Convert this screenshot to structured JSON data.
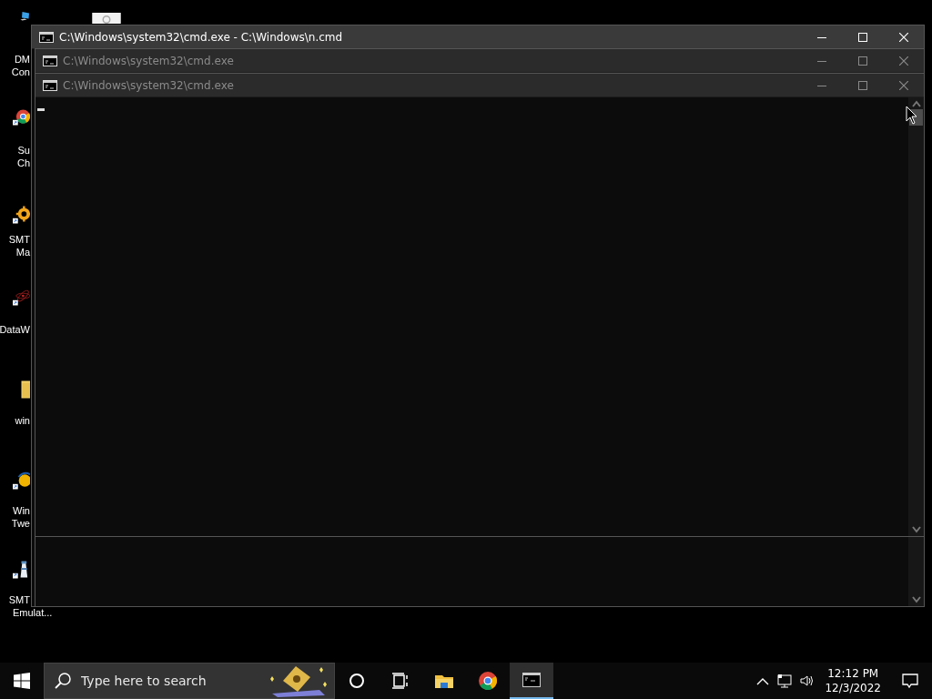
{
  "desktop_icons": [
    {
      "kind": "monitor",
      "label_lines": [
        "DM",
        "Con"
      ]
    },
    {
      "kind": "image"
    },
    {
      "kind": "chrome",
      "label_lines": [
        "Su",
        "Ch"
      ]
    },
    {
      "kind": "gear",
      "label_lines": [
        "SMT",
        "Ma"
      ]
    },
    {
      "kind": "atom",
      "label_lines": [
        "DataW"
      ]
    },
    {
      "kind": "folder",
      "label_lines": [
        "win"
      ]
    },
    {
      "kind": "tweaker",
      "label_lines": [
        "Win",
        "Twe"
      ]
    },
    {
      "kind": "lighthouse",
      "label_lines": [
        "SMT",
        "Emulat..."
      ]
    }
  ],
  "windows": [
    {
      "title": "C:\\Windows\\system32\\cmd.exe - C:\\Windows\\n.cmd",
      "active": true
    },
    {
      "title": "C:\\Windows\\system32\\cmd.exe",
      "active": false
    },
    {
      "title": "C:\\Windows\\system32\\cmd.exe",
      "active": false
    }
  ],
  "taskbar": {
    "search": {
      "placeholder": "Type here to search"
    },
    "apps": [
      {
        "kind": "cortana",
        "selected": false
      },
      {
        "kind": "taskview",
        "selected": false
      },
      {
        "kind": "explorer",
        "selected": false
      },
      {
        "kind": "chrome",
        "selected": false
      },
      {
        "kind": "cmd",
        "selected": true
      }
    ],
    "clock": {
      "time": "12:12 PM",
      "date": "12/3/2022"
    }
  }
}
